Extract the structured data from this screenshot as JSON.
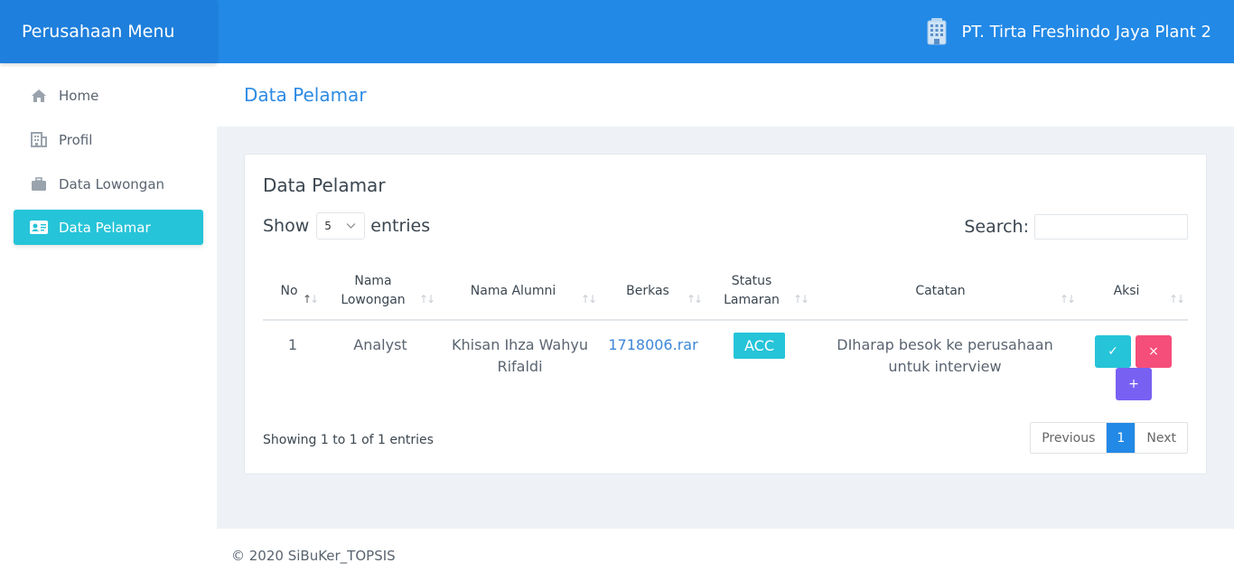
{
  "brand": "Perusahaan Menu",
  "company": "PT. Tirta Freshindo Jaya Plant 2",
  "sidebar": {
    "items": [
      {
        "label": "Home",
        "icon": "home-icon"
      },
      {
        "label": "Profil",
        "icon": "building-icon"
      },
      {
        "label": "Data Lowongan",
        "icon": "briefcase-icon"
      },
      {
        "label": "Data Pelamar",
        "icon": "id-card-icon",
        "active": true
      }
    ]
  },
  "page_title": "Data Pelamar",
  "card": {
    "title": "Data Pelamar",
    "show_label": "Show",
    "entries_label": "entries",
    "length_value": "5",
    "search_label": "Search:",
    "search_value": ""
  },
  "table": {
    "headers": [
      "No",
      "Nama Lowongan",
      "Nama Alumni",
      "Berkas",
      "Status Lamaran",
      "Catatan",
      "Aksi"
    ],
    "rows": [
      {
        "no": "1",
        "lowongan": "Analyst",
        "alumni": "Khisan Ihza Wahyu Rifaldi",
        "berkas": "1718006.rar",
        "status": "ACC",
        "catatan": "DIharap besok ke perusahaan untuk interview",
        "actions": [
          "✓",
          "×",
          "+"
        ]
      }
    ]
  },
  "info": "Showing 1 to 1 of 1 entries",
  "pagination": {
    "previous": "Previous",
    "current": "1",
    "next": "Next"
  },
  "footer": "© 2020 SiBuKer_TOPSIS",
  "colors": {
    "primary": "#2289e6",
    "accent": "#26c4d8",
    "danger": "#f54e7a",
    "purple": "#7861f2"
  }
}
